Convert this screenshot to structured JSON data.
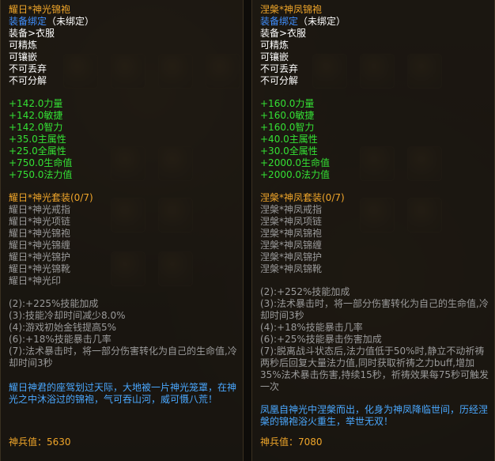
{
  "left": {
    "name": "耀日*神光锦袍",
    "bind": "装备绑定",
    "bind_status": "（未绑定）",
    "type": "装备>衣服",
    "flags": [
      "可精炼",
      "可镶嵌",
      "不可丢弃",
      "不可分解"
    ],
    "stats": [
      "+142.0力量",
      "+142.0敏捷",
      "+142.0智力",
      "+35.0主属性",
      "+25.0全属性",
      "+750.0生命值",
      "+750.0法力值"
    ],
    "set_title": "耀日*神光套装(0/7)",
    "set_items": [
      "耀日*神光戒指",
      "耀日*神光项链",
      "耀日*神光锦袍",
      "耀日*神光锦缠",
      "耀日*神光锦护",
      "耀日*神光锦靴",
      "耀日*神光印"
    ],
    "set_bonuses": [
      "(2):+225%技能加成",
      "(3):技能冷却时间减少8.0%",
      "(4):游戏初始金钱提高5%",
      "(6):+18%技能暴击几率",
      "(7):法术暴击时，将一部分伤害转化为自己的生命值,冷却时间3秒"
    ],
    "lore": "耀日神君的座驾划过天际，大地被一片神光笼罩，在神光之中沐浴过的锦袍，气可吞山河，威可慑八荒！",
    "power_label": "神兵值：",
    "power_value": "5630"
  },
  "right": {
    "name": "涅槃*神凤锦袍",
    "bind": "装备绑定",
    "bind_status": "（未绑定）",
    "type": "装备>衣服",
    "flags": [
      "可精炼",
      "可镶嵌",
      "不可丢弃",
      "不可分解"
    ],
    "stats": [
      "+160.0力量",
      "+160.0敏捷",
      "+160.0智力",
      "+40.0主属性",
      "+30.0全属性",
      "+2000.0生命值",
      "+2000.0法力值"
    ],
    "set_title": "涅槃*神凤套装(0/7)",
    "set_items": [
      "涅槃*神凤戒指",
      "涅槃*神凤项链",
      "涅槃*神凤锦袍",
      "涅槃*神凤锦缠",
      "涅槃*神凤锦护",
      "涅槃*神凤锦靴"
    ],
    "set_bonuses": [
      "(2):+252%技能加成",
      "(3):法术暴击时，将一部分伤害转化为自己的生命值,冷却时间3秒",
      "(4):+18%技能暴击几率",
      "(6):+25%技能暴击伤害加成",
      "(7):脱离战斗状态后,法力值低于50%时,静立不动祈祷两秒后回复大量法力值,同时获取祈祷之力buff,增加35%法术暴击伤害,持续15秒，祈祷效果每75秒可触发一次"
    ],
    "lore": "凤凰自神光中涅槃而出，化身为神凤降临世间，历经涅槃的锦袍浴火重生，举世无双！",
    "power_label": "神兵值：",
    "power_value": "7080"
  }
}
